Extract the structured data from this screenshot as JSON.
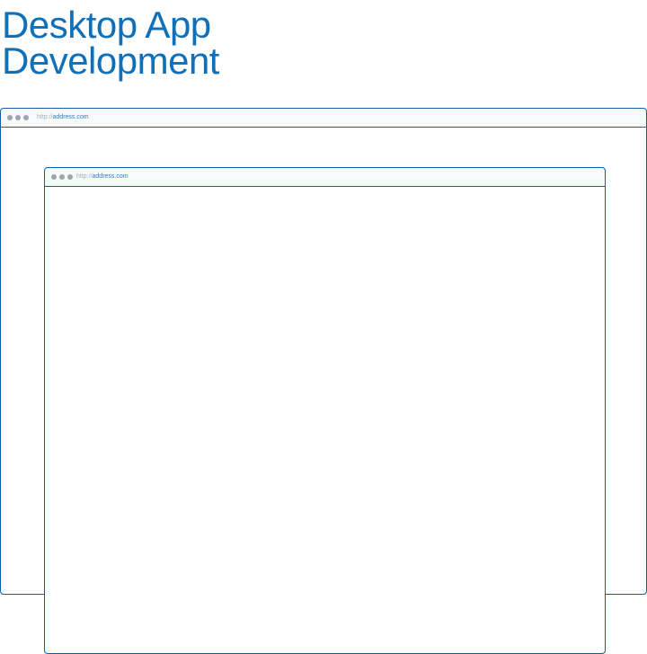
{
  "page": {
    "title_line1": "Desktop App",
    "title_line2": "Development"
  },
  "windows": [
    {
      "name": "back",
      "address_scheme": "http://",
      "address_host": "address.com"
    },
    {
      "name": "front",
      "address_scheme": "http://",
      "address_host": "address.com"
    }
  ],
  "colors": {
    "accent": "#0f6fb8",
    "border": "#0f5fa6",
    "dot": "#9aa4ad"
  },
  "icons": {
    "window_controls": "three-gray-dots-icon"
  }
}
